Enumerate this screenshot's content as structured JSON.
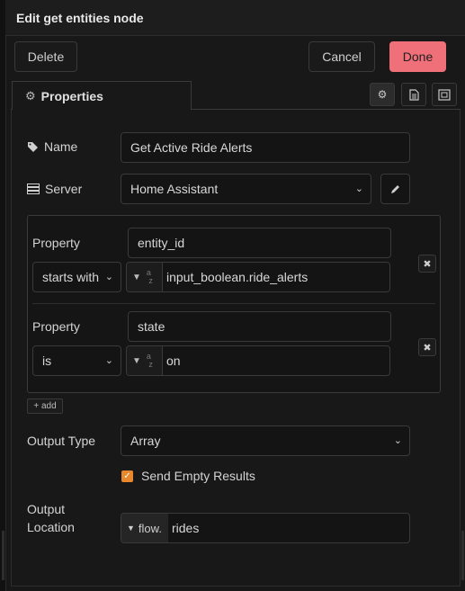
{
  "tray": {
    "title": "Edit get entities node",
    "delete_label": "Delete",
    "cancel_label": "Cancel",
    "done_label": "Done"
  },
  "tabs": {
    "properties_label": "Properties"
  },
  "form": {
    "name_label": "Name",
    "name_value": "Get Active Ride Alerts",
    "server_label": "Server",
    "server_value": "Home Assistant",
    "rules": [
      {
        "property_label": "Property",
        "property_value": "entity_id",
        "operator": "starts with",
        "value": "input_boolean.ride_alerts"
      },
      {
        "property_label": "Property",
        "property_value": "state",
        "operator": "is",
        "value": "on"
      }
    ],
    "add_label": "add",
    "output_type_label": "Output Type",
    "output_type_value": "Array",
    "send_empty_label": "Send Empty Results",
    "send_empty_checked": true,
    "output_location_label_1": "Output",
    "output_location_label_2": "Location",
    "output_location_type": "flow.",
    "output_location_value": "rides"
  },
  "colors": {
    "accent": "#f0707a",
    "checkbox": "#e8872c"
  }
}
